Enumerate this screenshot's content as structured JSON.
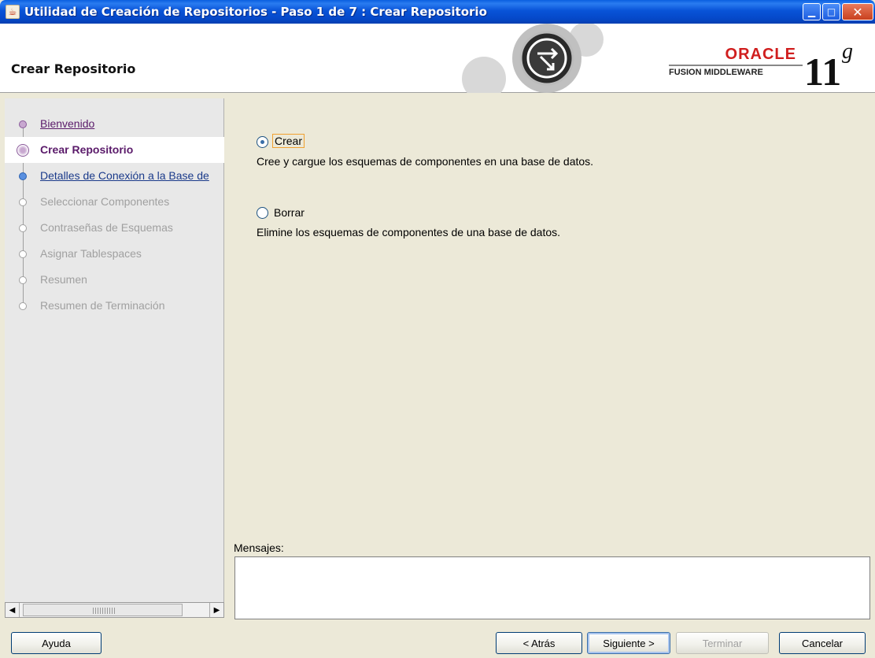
{
  "window": {
    "title": "Utilidad de Creación de Repositorios - Paso 1 de 7 : Crear Repositorio",
    "app_icon": "java-cup-icon",
    "controls": [
      "minimize",
      "maximize",
      "close"
    ]
  },
  "header": {
    "page_title": "Crear Repositorio",
    "brand": {
      "company": "ORACLE",
      "product": "FUSION MIDDLEWARE",
      "version_main": "11",
      "version_suffix": "g",
      "brand_color": "#d01e1e"
    }
  },
  "nav": {
    "items": [
      {
        "label": "Bienvenido",
        "state": "visited"
      },
      {
        "label": "Crear Repositorio",
        "state": "current"
      },
      {
        "label": "Detalles de Conexión a la Base de",
        "state": "next"
      },
      {
        "label": "Seleccionar Componentes",
        "state": "disabled"
      },
      {
        "label": "Contraseñas de Esquemas",
        "state": "disabled"
      },
      {
        "label": "Asignar Tablespaces",
        "state": "disabled"
      },
      {
        "label": "Resumen",
        "state": "disabled"
      },
      {
        "label": "Resumen de Terminación",
        "state": "disabled"
      }
    ]
  },
  "main": {
    "options": [
      {
        "label": "Crear",
        "description": "Cree y cargue los esquemas de componentes en una base de datos.",
        "checked": true
      },
      {
        "label": "Borrar",
        "description": "Elimine los esquemas de componentes de una base de datos.",
        "checked": false
      }
    ],
    "messages_label": "Mensajes:",
    "messages_text": ""
  },
  "footer": {
    "help_label": "Ayuda",
    "back_label": "< Atrás",
    "next_label": "Siguiente >",
    "finish_label": "Terminar",
    "cancel_label": "Cancelar"
  }
}
